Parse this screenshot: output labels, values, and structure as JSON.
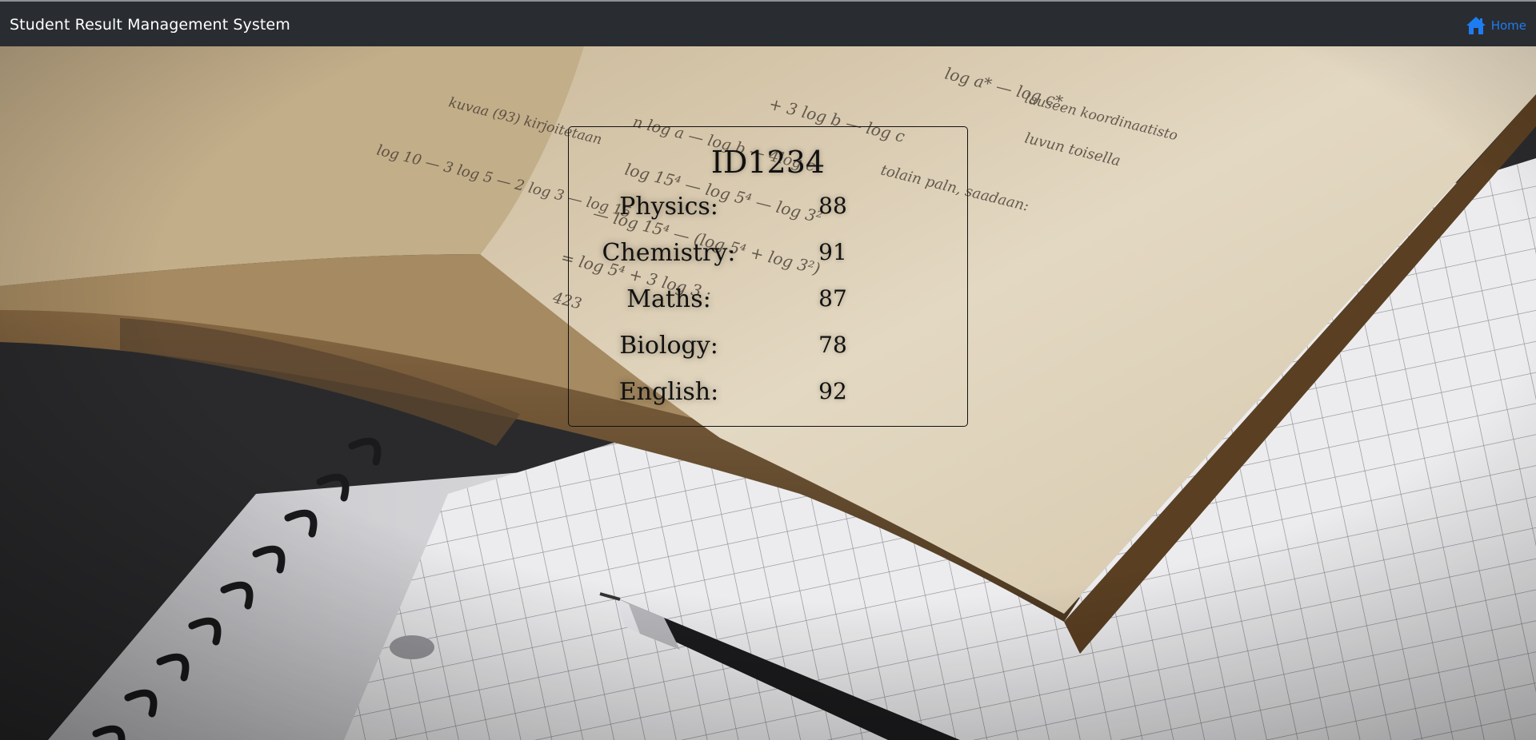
{
  "navbar": {
    "brand": "Student Result Management System",
    "home_label": "Home",
    "home_icon": "home-icon",
    "background_color": "#292c31",
    "link_color": "#1e7cf2"
  },
  "result": {
    "student_id": "ID1234",
    "subjects": [
      {
        "name": "Physics:",
        "score": "88"
      },
      {
        "name": "Chemistry:",
        "score": "91"
      },
      {
        "name": "Maths:",
        "score": "87"
      },
      {
        "name": "Biology:",
        "score": "78"
      },
      {
        "name": "English:",
        "score": "92"
      }
    ]
  }
}
